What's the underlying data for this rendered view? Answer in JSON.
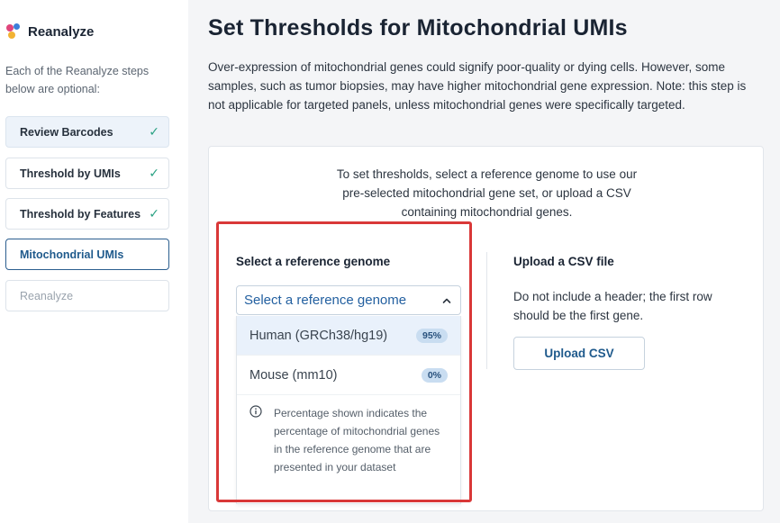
{
  "sidebar": {
    "app_name": "Reanalyze",
    "intro": "Each of the Reanalyze steps below are optional:",
    "steps": [
      {
        "label": "Review Barcodes",
        "status": "done"
      },
      {
        "label": "Threshold by UMIs",
        "status": "done"
      },
      {
        "label": "Threshold by Features",
        "status": "done"
      },
      {
        "label": "Mitochondrial UMIs",
        "status": "active"
      },
      {
        "label": "Reanalyze",
        "status": "disabled"
      }
    ],
    "check_icon": "check-icon"
  },
  "main": {
    "title": "Set Thresholds for Mitochondrial UMIs",
    "description": "Over-expression of mitochondrial genes could signify poor-quality or dying cells. However, some samples, such as tumor biopsies, may have higher mitochondrial gene expression. Note: this step is not applicable for targeted panels, unless mitochondrial genes were specifically targeted.",
    "card": {
      "intro_lines": [
        "To set thresholds, select a reference genome to use our",
        "pre-selected mitochondrial gene set, or upload a CSV",
        "containing mitochondrial genes."
      ],
      "reference": {
        "heading": "Select a reference genome",
        "select_label": "Select a reference genome",
        "options": [
          {
            "label": "Human (GRCh38/hg19)",
            "badge": "95%"
          },
          {
            "label": "Mouse (mm10)",
            "badge": "0%"
          }
        ],
        "info_text": "Percentage shown indicates the percentage of mitochondrial genes in the reference genome that are presented in your dataset"
      },
      "csv": {
        "heading": "Upload a CSV file",
        "description": "Do not include a header; the first row should be the first gene.",
        "button_label": "Upload CSV"
      }
    }
  },
  "colors": {
    "accent": "#1f5a8c",
    "check": "#2aa283",
    "highlight": "#d93838",
    "badge_bg": "#c9ddf1"
  }
}
